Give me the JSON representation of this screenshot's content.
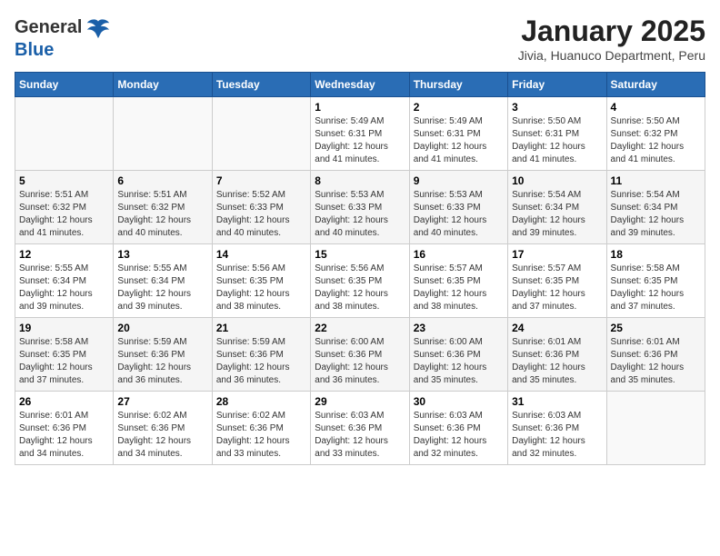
{
  "header": {
    "logo_general": "General",
    "logo_blue": "Blue",
    "title": "January 2025",
    "subtitle": "Jivia, Huanuco Department, Peru"
  },
  "weekdays": [
    "Sunday",
    "Monday",
    "Tuesday",
    "Wednesday",
    "Thursday",
    "Friday",
    "Saturday"
  ],
  "weeks": [
    [
      {
        "day": "",
        "info": ""
      },
      {
        "day": "",
        "info": ""
      },
      {
        "day": "",
        "info": ""
      },
      {
        "day": "1",
        "info": "Sunrise: 5:49 AM\nSunset: 6:31 PM\nDaylight: 12 hours\nand 41 minutes."
      },
      {
        "day": "2",
        "info": "Sunrise: 5:49 AM\nSunset: 6:31 PM\nDaylight: 12 hours\nand 41 minutes."
      },
      {
        "day": "3",
        "info": "Sunrise: 5:50 AM\nSunset: 6:31 PM\nDaylight: 12 hours\nand 41 minutes."
      },
      {
        "day": "4",
        "info": "Sunrise: 5:50 AM\nSunset: 6:32 PM\nDaylight: 12 hours\nand 41 minutes."
      }
    ],
    [
      {
        "day": "5",
        "info": "Sunrise: 5:51 AM\nSunset: 6:32 PM\nDaylight: 12 hours\nand 41 minutes."
      },
      {
        "day": "6",
        "info": "Sunrise: 5:51 AM\nSunset: 6:32 PM\nDaylight: 12 hours\nand 40 minutes."
      },
      {
        "day": "7",
        "info": "Sunrise: 5:52 AM\nSunset: 6:33 PM\nDaylight: 12 hours\nand 40 minutes."
      },
      {
        "day": "8",
        "info": "Sunrise: 5:53 AM\nSunset: 6:33 PM\nDaylight: 12 hours\nand 40 minutes."
      },
      {
        "day": "9",
        "info": "Sunrise: 5:53 AM\nSunset: 6:33 PM\nDaylight: 12 hours\nand 40 minutes."
      },
      {
        "day": "10",
        "info": "Sunrise: 5:54 AM\nSunset: 6:34 PM\nDaylight: 12 hours\nand 39 minutes."
      },
      {
        "day": "11",
        "info": "Sunrise: 5:54 AM\nSunset: 6:34 PM\nDaylight: 12 hours\nand 39 minutes."
      }
    ],
    [
      {
        "day": "12",
        "info": "Sunrise: 5:55 AM\nSunset: 6:34 PM\nDaylight: 12 hours\nand 39 minutes."
      },
      {
        "day": "13",
        "info": "Sunrise: 5:55 AM\nSunset: 6:34 PM\nDaylight: 12 hours\nand 39 minutes."
      },
      {
        "day": "14",
        "info": "Sunrise: 5:56 AM\nSunset: 6:35 PM\nDaylight: 12 hours\nand 38 minutes."
      },
      {
        "day": "15",
        "info": "Sunrise: 5:56 AM\nSunset: 6:35 PM\nDaylight: 12 hours\nand 38 minutes."
      },
      {
        "day": "16",
        "info": "Sunrise: 5:57 AM\nSunset: 6:35 PM\nDaylight: 12 hours\nand 38 minutes."
      },
      {
        "day": "17",
        "info": "Sunrise: 5:57 AM\nSunset: 6:35 PM\nDaylight: 12 hours\nand 37 minutes."
      },
      {
        "day": "18",
        "info": "Sunrise: 5:58 AM\nSunset: 6:35 PM\nDaylight: 12 hours\nand 37 minutes."
      }
    ],
    [
      {
        "day": "19",
        "info": "Sunrise: 5:58 AM\nSunset: 6:35 PM\nDaylight: 12 hours\nand 37 minutes."
      },
      {
        "day": "20",
        "info": "Sunrise: 5:59 AM\nSunset: 6:36 PM\nDaylight: 12 hours\nand 36 minutes."
      },
      {
        "day": "21",
        "info": "Sunrise: 5:59 AM\nSunset: 6:36 PM\nDaylight: 12 hours\nand 36 minutes."
      },
      {
        "day": "22",
        "info": "Sunrise: 6:00 AM\nSunset: 6:36 PM\nDaylight: 12 hours\nand 36 minutes."
      },
      {
        "day": "23",
        "info": "Sunrise: 6:00 AM\nSunset: 6:36 PM\nDaylight: 12 hours\nand 35 minutes."
      },
      {
        "day": "24",
        "info": "Sunrise: 6:01 AM\nSunset: 6:36 PM\nDaylight: 12 hours\nand 35 minutes."
      },
      {
        "day": "25",
        "info": "Sunrise: 6:01 AM\nSunset: 6:36 PM\nDaylight: 12 hours\nand 35 minutes."
      }
    ],
    [
      {
        "day": "26",
        "info": "Sunrise: 6:01 AM\nSunset: 6:36 PM\nDaylight: 12 hours\nand 34 minutes."
      },
      {
        "day": "27",
        "info": "Sunrise: 6:02 AM\nSunset: 6:36 PM\nDaylight: 12 hours\nand 34 minutes."
      },
      {
        "day": "28",
        "info": "Sunrise: 6:02 AM\nSunset: 6:36 PM\nDaylight: 12 hours\nand 33 minutes."
      },
      {
        "day": "29",
        "info": "Sunrise: 6:03 AM\nSunset: 6:36 PM\nDaylight: 12 hours\nand 33 minutes."
      },
      {
        "day": "30",
        "info": "Sunrise: 6:03 AM\nSunset: 6:36 PM\nDaylight: 12 hours\nand 32 minutes."
      },
      {
        "day": "31",
        "info": "Sunrise: 6:03 AM\nSunset: 6:36 PM\nDaylight: 12 hours\nand 32 minutes."
      },
      {
        "day": "",
        "info": ""
      }
    ]
  ]
}
